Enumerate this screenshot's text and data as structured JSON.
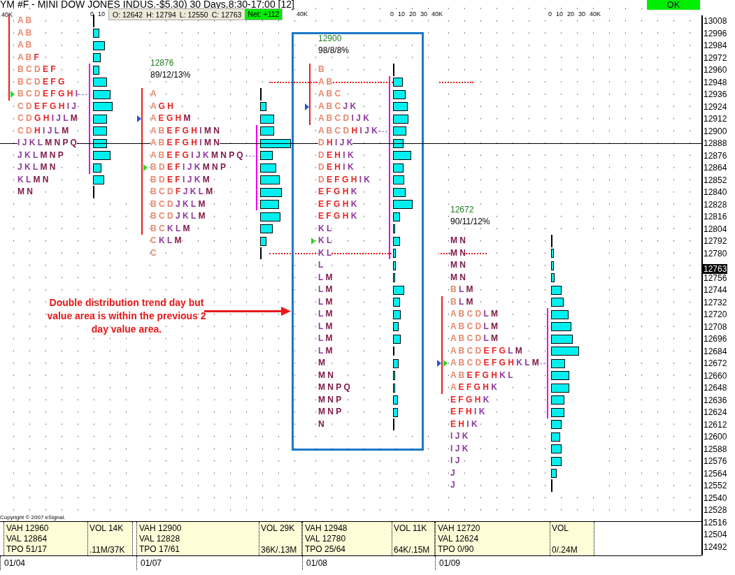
{
  "title": "YM #F - MINI DOW JONES INDUS.-$5.30) 30 Days,8:30-17:00 [12]",
  "ok_button": "OK",
  "ohlc": {
    "items": [
      {
        "label": "O:",
        "value": "12642"
      },
      {
        "label": "H:",
        "value": "12794"
      },
      {
        "label": "L:",
        "value": "12550"
      },
      {
        "label": "C:",
        "value": "12763"
      }
    ],
    "net": {
      "label": "Net:",
      "value": "+112"
    }
  },
  "corner_scale_label": "40K",
  "price_axis": {
    "labels": [
      "13008",
      "12996",
      "12984",
      "12972",
      "12960",
      "12948",
      "12936",
      "12924",
      "12912",
      "12900",
      "12888",
      "12876",
      "12864",
      "12852",
      "12840",
      "12828",
      "12816",
      "12804",
      "12792",
      "12780",
      "12756",
      "12744",
      "12732",
      "12720",
      "12708",
      "12696",
      "12684",
      "12672",
      "12660",
      "12648",
      "12636",
      "12624",
      "12612",
      "12600",
      "12588",
      "12576",
      "12564",
      "12552",
      "12540",
      "12528",
      "12516",
      "12504",
      "12492"
    ],
    "last_price": "12763"
  },
  "annotation": {
    "text": "Double distribution trend day but value area is within the previous 2 day value area."
  },
  "copyright": "Copyright © 2007 eSignal.",
  "days": [
    {
      "date": "01/04",
      "scale": {
        "kind": "head",
        "labels": [
          "0",
          "10"
        ]
      },
      "highlighted": false,
      "extended_value_area": false,
      "rows": [
        {
          "groups": [
            {
              "text": "A B",
              "color": "#e8886c"
            }
          ],
          "level": 0,
          "poc": false,
          "in_range": true,
          "value_area": false
        },
        {
          "groups": [
            {
              "text": "A B",
              "color": "#e8886c"
            }
          ],
          "level": 0.14,
          "poc": false,
          "in_range": true,
          "value_area": false
        },
        {
          "groups": [
            {
              "text": "A B",
              "color": "#e8886c"
            }
          ],
          "level": 0.26,
          "poc": false,
          "in_range": true,
          "value_area": false
        },
        {
          "groups": [
            {
              "text": "A B",
              "color": "#e8886c"
            },
            {
              "text": "F",
              "color": "#ee2020"
            }
          ],
          "level": 0.17,
          "poc": false,
          "in_range": true,
          "value_area": false
        },
        {
          "groups": [
            {
              "text": "B C D",
              "color": "#e8886c"
            },
            {
              "text": "E F",
              "color": "#ee2020"
            }
          ],
          "level": 0.14,
          "poc": false,
          "in_range": true,
          "value_area": true
        },
        {
          "groups": [
            {
              "text": "B C D",
              "color": "#e8886c"
            },
            {
              "text": "E F G",
              "color": "#ee2020"
            }
          ],
          "level": 0.31,
          "poc": false,
          "in_range": true,
          "value_area": true
        },
        {
          "groups": [
            {
              "text": "B C D",
              "color": "#e8886c"
            },
            {
              "text": "E F G H",
              "color": "#ee2020"
            },
            {
              "text": "I",
              "color": "#8e3a9e"
            }
          ],
          "level": 0.38,
          "poc": true,
          "in_range": true,
          "value_area": true,
          "markers": [
            {
              "kind": "inner",
              "color": "#22dd22"
            }
          ]
        },
        {
          "groups": [
            {
              "text": "C D",
              "color": "#e8886c"
            },
            {
              "text": "E F G H",
              "color": "#ee2020"
            },
            {
              "text": "I J",
              "color": "#8e3a9e"
            }
          ],
          "level": 0.43,
          "poc": false,
          "in_range": false,
          "value_area": true
        },
        {
          "groups": [
            {
              "text": "C D",
              "color": "#e8886c"
            },
            {
              "text": "G H",
              "color": "#ee2020"
            },
            {
              "text": "I J L",
              "color": "#8e3a9e"
            },
            {
              "text": "M",
              "color": "#801848"
            }
          ],
          "level": 0.31,
          "poc": false,
          "in_range": false,
          "value_area": true
        },
        {
          "groups": [
            {
              "text": "C D",
              "color": "#e8886c"
            },
            {
              "text": "H",
              "color": "#ee2020"
            },
            {
              "text": "I J L",
              "color": "#8e3a9e"
            },
            {
              "text": "M",
              "color": "#801848"
            }
          ],
          "level": 0.31,
          "poc": false,
          "in_range": false,
          "value_area": true
        },
        {
          "groups": [
            {
              "text": "I J K L",
              "color": "#8e3a9e"
            },
            {
              "text": "M N P Q",
              "color": "#801848"
            }
          ],
          "level": 0.31,
          "poc": false,
          "in_range": false,
          "value_area": true
        },
        {
          "groups": [
            {
              "text": "J K L",
              "color": "#8e3a9e"
            },
            {
              "text": "M N P",
              "color": "#801848"
            }
          ],
          "level": 0.38,
          "poc": false,
          "in_range": false,
          "value_area": true
        },
        {
          "groups": [
            {
              "text": "J K L",
              "color": "#8e3a9e"
            },
            {
              "text": "M N",
              "color": "#801848"
            }
          ],
          "level": 0.18,
          "poc": false,
          "in_range": false,
          "value_area": true
        },
        {
          "groups": [
            {
              "text": "K L",
              "color": "#8e3a9e"
            },
            {
              "text": "M N",
              "color": "#801848"
            }
          ],
          "level": 0.25,
          "poc": false,
          "in_range": false,
          "value_area": false
        },
        {
          "groups": [
            {
              "text": "M N",
              "color": "#801848"
            }
          ],
          "level": 0,
          "poc": false,
          "in_range": false,
          "value_area": false
        }
      ],
      "footer": {
        "stats": [
          {
            "label": "VAH",
            "value": "12960"
          },
          {
            "label": "VAL",
            "value": "12864"
          },
          {
            "label": "TPO",
            "value": "51/17"
          }
        ],
        "vol": {
          "label": "VOL",
          "value": "14K",
          "ratio": ".11M/37K"
        }
      }
    },
    {
      "date": "01/07",
      "poc_label": "12876",
      "stats_label": "89/12/13%",
      "scale": {
        "kind": "tail",
        "labels": [
          "40K"
        ]
      },
      "highlighted": false,
      "extended_value_area": false,
      "rows": [
        {
          "groups": [
            {
              "text": "A",
              "color": "#e8886c"
            }
          ],
          "level": 0,
          "poc": false,
          "in_range": true,
          "value_area": false
        },
        {
          "groups": [
            {
              "text": "A",
              "color": "#e8886c"
            },
            {
              "text": "G H",
              "color": "#ee2020"
            }
          ],
          "level": 0.14,
          "poc": false,
          "in_range": true,
          "value_area": false
        },
        {
          "groups": [
            {
              "text": "A",
              "color": "#e8886c"
            },
            {
              "text": "E G H",
              "color": "#ee2020"
            },
            {
              "text": "M",
              "color": "#801848"
            }
          ],
          "level": 0.31,
          "poc": false,
          "in_range": true,
          "value_area": false,
          "markers": [
            {
              "kind": "outer",
              "color": "#2255dd"
            }
          ]
        },
        {
          "groups": [
            {
              "text": "A B",
              "color": "#e8886c"
            },
            {
              "text": "E F G H",
              "color": "#ee2020"
            },
            {
              "text": "I",
              "color": "#8e3a9e"
            },
            {
              "text": "M N",
              "color": "#801848"
            }
          ],
          "level": 0.31,
          "poc": false,
          "in_range": true,
          "value_area": true
        },
        {
          "groups": [
            {
              "text": "A B",
              "color": "#e8886c"
            },
            {
              "text": "E F G H",
              "color": "#ee2020"
            },
            {
              "text": "I",
              "color": "#8e3a9e"
            },
            {
              "text": "M N",
              "color": "#801848"
            }
          ],
          "level": 0.68,
          "poc": false,
          "in_range": true,
          "value_area": true
        },
        {
          "groups": [
            {
              "text": "A B",
              "color": "#e8886c"
            },
            {
              "text": "E F G",
              "color": "#ee2020"
            },
            {
              "text": "I J K",
              "color": "#8e3a9e"
            },
            {
              "text": "M N P Q",
              "color": "#801848"
            }
          ],
          "level": 0.28,
          "poc": true,
          "in_range": true,
          "value_area": true
        },
        {
          "groups": [
            {
              "text": "B D",
              "color": "#e8886c"
            },
            {
              "text": "E F",
              "color": "#ee2020"
            },
            {
              "text": "I J K",
              "color": "#8e3a9e"
            },
            {
              "text": "M N P",
              "color": "#801848"
            }
          ],
          "level": 0.35,
          "poc": false,
          "in_range": true,
          "value_area": true,
          "markers": [
            {
              "kind": "inner",
              "color": "#22dd22"
            }
          ]
        },
        {
          "groups": [
            {
              "text": "B D",
              "color": "#e8886c"
            },
            {
              "text": "E F",
              "color": "#ee2020"
            },
            {
              "text": "I J K",
              "color": "#8e3a9e"
            },
            {
              "text": "M",
              "color": "#801848"
            }
          ],
          "level": 0.43,
          "poc": false,
          "in_range": true,
          "value_area": true
        },
        {
          "groups": [
            {
              "text": "B C D",
              "color": "#e8886c"
            },
            {
              "text": "F",
              "color": "#ee2020"
            },
            {
              "text": "J K L",
              "color": "#8e3a9e"
            },
            {
              "text": "M",
              "color": "#801848"
            }
          ],
          "level": 0.48,
          "poc": false,
          "in_range": true,
          "value_area": true
        },
        {
          "groups": [
            {
              "text": "B C D",
              "color": "#e8886c"
            },
            {
              "text": "J K L",
              "color": "#8e3a9e"
            },
            {
              "text": "M",
              "color": "#801848"
            }
          ],
          "level": 0.42,
          "poc": false,
          "in_range": true,
          "value_area": true
        },
        {
          "groups": [
            {
              "text": "B C D",
              "color": "#e8886c"
            },
            {
              "text": "J K L",
              "color": "#8e3a9e"
            },
            {
              "text": "M",
              "color": "#801848"
            }
          ],
          "level": 0.45,
          "poc": false,
          "in_range": true,
          "value_area": false
        },
        {
          "groups": [
            {
              "text": "B C",
              "color": "#e8886c"
            },
            {
              "text": "K L",
              "color": "#8e3a9e"
            },
            {
              "text": "M",
              "color": "#801848"
            }
          ],
          "level": 0.28,
          "poc": false,
          "in_range": true,
          "value_area": false
        },
        {
          "groups": [
            {
              "text": "C",
              "color": "#e8886c"
            },
            {
              "text": "K L",
              "color": "#8e3a9e"
            },
            {
              "text": "M",
              "color": "#801848"
            }
          ],
          "level": 0.14,
          "poc": false,
          "in_range": false,
          "value_area": false
        },
        {
          "groups": [
            {
              "text": "C",
              "color": "#e8886c"
            }
          ],
          "level": 0,
          "poc": false,
          "in_range": false,
          "value_area": false
        }
      ],
      "footer": {
        "stats": [
          {
            "label": "VAH",
            "value": "12900"
          },
          {
            "label": "VAL",
            "value": "12828"
          },
          {
            "label": "TPO",
            "value": "17/61"
          }
        ],
        "vol": {
          "label": "VOL",
          "value": "29K",
          "ratio": "36K/.13M"
        }
      }
    },
    {
      "date": "01/08",
      "poc_label": "12900",
      "stats_label": "98/8/8%",
      "scale": {
        "kind": "full",
        "labels": [
          "0",
          "10",
          "20",
          "30",
          "40K"
        ]
      },
      "highlighted": true,
      "extended_value_area": true,
      "rows": [
        {
          "groups": [
            {
              "text": "B",
              "color": "#e8886c"
            }
          ],
          "level": 0,
          "poc": false,
          "in_range": true,
          "value_area": false
        },
        {
          "groups": [
            {
              "text": "A B",
              "color": "#e8886c"
            }
          ],
          "level": 0.22,
          "poc": false,
          "in_range": true,
          "value_area": true
        },
        {
          "groups": [
            {
              "text": "A B C",
              "color": "#e8886c"
            }
          ],
          "level": 0.28,
          "poc": false,
          "in_range": true,
          "value_area": true
        },
        {
          "groups": [
            {
              "text": "A B C",
              "color": "#e8886c"
            },
            {
              "text": "J K",
              "color": "#8e3a9e"
            }
          ],
          "level": 0.32,
          "poc": false,
          "in_range": true,
          "value_area": true,
          "markers": [
            {
              "kind": "outer",
              "color": "#2255dd"
            }
          ]
        },
        {
          "groups": [
            {
              "text": "A B C D",
              "color": "#e8886c"
            },
            {
              "text": "I J K",
              "color": "#8e3a9e"
            }
          ],
          "level": 0.34,
          "poc": false,
          "in_range": true,
          "value_area": true
        },
        {
          "groups": [
            {
              "text": "A B C D",
              "color": "#e8886c"
            },
            {
              "text": "H",
              "color": "#ee2020"
            },
            {
              "text": "I J K",
              "color": "#8e3a9e"
            }
          ],
          "level": 0.29,
          "poc": true,
          "in_range": false,
          "value_area": true
        },
        {
          "groups": [
            {
              "text": "D",
              "color": "#e8886c"
            },
            {
              "text": "H",
              "color": "#ee2020"
            },
            {
              "text": "I J K",
              "color": "#8e3a9e"
            }
          ],
          "level": 0.23,
          "poc": false,
          "in_range": false,
          "value_area": true
        },
        {
          "groups": [
            {
              "text": "D",
              "color": "#e8886c"
            },
            {
              "text": "E H",
              "color": "#ee2020"
            },
            {
              "text": "I K",
              "color": "#8e3a9e"
            }
          ],
          "level": 0.4,
          "poc": false,
          "in_range": false,
          "value_area": true
        },
        {
          "groups": [
            {
              "text": "D",
              "color": "#e8886c"
            },
            {
              "text": "E H",
              "color": "#ee2020"
            },
            {
              "text": "I K",
              "color": "#8e3a9e"
            }
          ],
          "level": 0.23,
          "poc": false,
          "in_range": false,
          "value_area": true
        },
        {
          "groups": [
            {
              "text": "D",
              "color": "#e8886c"
            },
            {
              "text": "E F G H",
              "color": "#ee2020"
            },
            {
              "text": "I K",
              "color": "#8e3a9e"
            }
          ],
          "level": 0.25,
          "poc": false,
          "in_range": false,
          "value_area": true
        },
        {
          "groups": [
            {
              "text": "E F G H",
              "color": "#ee2020"
            },
            {
              "text": "K",
              "color": "#8e3a9e"
            }
          ],
          "level": 0.28,
          "poc": false,
          "in_range": false,
          "value_area": true
        },
        {
          "groups": [
            {
              "text": "E F G H",
              "color": "#ee2020"
            },
            {
              "text": "K",
              "color": "#8e3a9e"
            }
          ],
          "level": 0.43,
          "poc": false,
          "in_range": false,
          "value_area": true
        },
        {
          "groups": [
            {
              "text": "E F G H",
              "color": "#ee2020"
            },
            {
              "text": "K",
              "color": "#8e3a9e"
            }
          ],
          "level": 0.15,
          "poc": false,
          "in_range": false,
          "value_area": true
        },
        {
          "groups": [
            {
              "text": "K L",
              "color": "#8e3a9e"
            }
          ],
          "level": 0.05,
          "poc": false,
          "in_range": false,
          "value_area": true
        },
        {
          "groups": [
            {
              "text": "K L",
              "color": "#8e3a9e"
            }
          ],
          "level": 0.15,
          "poc": false,
          "in_range": false,
          "value_area": true,
          "markers": [
            {
              "kind": "inner",
              "color": "#22dd22"
            }
          ]
        },
        {
          "groups": [
            {
              "text": "K L",
              "color": "#8e3a9e"
            }
          ],
          "level": 0.06,
          "poc": false,
          "in_range": false,
          "value_area": true
        },
        {
          "groups": [
            {
              "text": "L",
              "color": "#8e3a9e"
            }
          ],
          "level": 0.06,
          "poc": false,
          "in_range": false,
          "value_area": false
        },
        {
          "groups": [
            {
              "text": "L",
              "color": "#8e3a9e"
            },
            {
              "text": "M",
              "color": "#801848"
            }
          ],
          "level": 0.05,
          "poc": false,
          "in_range": false,
          "value_area": false
        },
        {
          "groups": [
            {
              "text": "L",
              "color": "#8e3a9e"
            },
            {
              "text": "M",
              "color": "#801848"
            }
          ],
          "level": 0.25,
          "poc": false,
          "in_range": false,
          "value_area": false
        },
        {
          "groups": [
            {
              "text": "L",
              "color": "#8e3a9e"
            },
            {
              "text": "M",
              "color": "#801848"
            }
          ],
          "level": 0.15,
          "poc": false,
          "in_range": false,
          "value_area": false
        },
        {
          "groups": [
            {
              "text": "L",
              "color": "#8e3a9e"
            },
            {
              "text": "M",
              "color": "#801848"
            }
          ],
          "level": 0.17,
          "poc": false,
          "in_range": false,
          "value_area": false
        },
        {
          "groups": [
            {
              "text": "L",
              "color": "#8e3a9e"
            },
            {
              "text": "M",
              "color": "#801848"
            }
          ],
          "level": 0.12,
          "poc": false,
          "in_range": false,
          "value_area": false
        },
        {
          "groups": [
            {
              "text": "L",
              "color": "#8e3a9e"
            },
            {
              "text": "M",
              "color": "#801848"
            }
          ],
          "level": 0.17,
          "poc": false,
          "in_range": false,
          "value_area": false
        },
        {
          "groups": [
            {
              "text": "L",
              "color": "#8e3a9e"
            },
            {
              "text": "M",
              "color": "#801848"
            }
          ],
          "level": 0.03,
          "poc": false,
          "in_range": false,
          "value_area": false
        },
        {
          "groups": [
            {
              "text": "M",
              "color": "#801848"
            }
          ],
          "level": 0.12,
          "poc": false,
          "in_range": false,
          "value_area": false
        },
        {
          "groups": [
            {
              "text": "M N",
              "color": "#801848"
            }
          ],
          "level": 0.05,
          "poc": false,
          "in_range": false,
          "value_area": false
        },
        {
          "groups": [
            {
              "text": "M N P Q",
              "color": "#801848"
            }
          ],
          "level": 0.05,
          "poc": false,
          "in_range": false,
          "value_area": false
        },
        {
          "groups": [
            {
              "text": "M N P",
              "color": "#801848"
            }
          ],
          "level": 0.11,
          "poc": false,
          "in_range": false,
          "value_area": false
        },
        {
          "groups": [
            {
              "text": "M N P",
              "color": "#801848"
            }
          ],
          "level": 0.11,
          "poc": false,
          "in_range": false,
          "value_area": false
        },
        {
          "groups": [
            {
              "text": "N",
              "color": "#801848"
            }
          ],
          "level": 0,
          "poc": false,
          "in_range": false,
          "value_area": false
        }
      ],
      "footer": {
        "stats": [
          {
            "label": "VAH",
            "value": "12948"
          },
          {
            "label": "VAL",
            "value": "12780"
          },
          {
            "label": "TPO",
            "value": "25/64"
          }
        ],
        "vol": {
          "label": "VOL",
          "value": "11K",
          "ratio": "64K/.15M"
        }
      }
    },
    {
      "date": "01/09",
      "poc_label": "12672",
      "stats_label": "90/11/12%",
      "scale": {
        "kind": "full",
        "labels": [
          "0",
          "10",
          "20",
          "30",
          "40K"
        ]
      },
      "highlighted": false,
      "extended_value_area": false,
      "rows": [
        {
          "groups": [
            {
              "text": "M N",
              "color": "#801848"
            }
          ],
          "level": 0,
          "poc": false,
          "in_range": false,
          "value_area": false
        },
        {
          "groups": [
            {
              "text": "M N",
              "color": "#801848"
            }
          ],
          "level": 0.06,
          "poc": false,
          "in_range": false,
          "value_area": false
        },
        {
          "groups": [
            {
              "text": "M N",
              "color": "#801848"
            }
          ],
          "level": 0.06,
          "poc": false,
          "in_range": false,
          "value_area": false
        },
        {
          "groups": [
            {
              "text": "M N",
              "color": "#801848"
            }
          ],
          "level": 0.08,
          "poc": false,
          "in_range": false,
          "value_area": false
        },
        {
          "groups": [
            {
              "text": "B",
              "color": "#e8886c"
            },
            {
              "text": "L",
              "color": "#8e3a9e"
            },
            {
              "text": "M",
              "color": "#801848"
            }
          ],
          "level": 0.23,
          "poc": false,
          "in_range": false,
          "value_area": false
        },
        {
          "groups": [
            {
              "text": "B",
              "color": "#e8886c"
            },
            {
              "text": "L",
              "color": "#8e3a9e"
            },
            {
              "text": "M",
              "color": "#801848"
            }
          ],
          "level": 0.28,
          "poc": false,
          "in_range": true,
          "value_area": false
        },
        {
          "groups": [
            {
              "text": "A B C D",
              "color": "#e8886c"
            },
            {
              "text": "L",
              "color": "#8e3a9e"
            },
            {
              "text": "M",
              "color": "#801848"
            }
          ],
          "level": 0.38,
          "poc": false,
          "in_range": true,
          "value_area": true
        },
        {
          "groups": [
            {
              "text": "A B C D",
              "color": "#e8886c"
            },
            {
              "text": "L",
              "color": "#8e3a9e"
            },
            {
              "text": "M",
              "color": "#801848"
            }
          ],
          "level": 0.45,
          "poc": false,
          "in_range": true,
          "value_area": true
        },
        {
          "groups": [
            {
              "text": "A B C D",
              "color": "#e8886c"
            },
            {
              "text": "L",
              "color": "#8e3a9e"
            },
            {
              "text": "M",
              "color": "#801848"
            }
          ],
          "level": 0.48,
          "poc": false,
          "in_range": true,
          "value_area": true
        },
        {
          "groups": [
            {
              "text": "A B C D",
              "color": "#e8886c"
            },
            {
              "text": "E F G",
              "color": "#ee2020"
            },
            {
              "text": "L",
              "color": "#8e3a9e"
            },
            {
              "text": "M",
              "color": "#801848"
            }
          ],
          "level": 0.62,
          "poc": false,
          "in_range": true,
          "value_area": true
        },
        {
          "groups": [
            {
              "text": "A B C D",
              "color": "#e8886c"
            },
            {
              "text": "E F G H",
              "color": "#ee2020"
            },
            {
              "text": "K L",
              "color": "#8e3a9e"
            },
            {
              "text": "M",
              "color": "#801848"
            }
          ],
          "level": 0.31,
          "poc": true,
          "in_range": true,
          "value_area": true,
          "markers": [
            {
              "kind": "outer",
              "color": "#2255dd"
            },
            {
              "kind": "inner",
              "color": "#22dd22"
            }
          ]
        },
        {
          "groups": [
            {
              "text": "A B",
              "color": "#e8886c"
            },
            {
              "text": "E F G H",
              "color": "#ee2020"
            },
            {
              "text": "K L",
              "color": "#8e3a9e"
            }
          ],
          "level": 0.4,
          "poc": false,
          "in_range": true,
          "value_area": true
        },
        {
          "groups": [
            {
              "text": "A",
              "color": "#e8886c"
            },
            {
              "text": "E F G H",
              "color": "#ee2020"
            },
            {
              "text": "K",
              "color": "#8e3a9e"
            }
          ],
          "level": 0.4,
          "poc": false,
          "in_range": true,
          "value_area": true
        },
        {
          "groups": [
            {
              "text": "E F G H",
              "color": "#ee2020"
            },
            {
              "text": "K",
              "color": "#8e3a9e"
            }
          ],
          "level": 0.29,
          "poc": false,
          "in_range": false,
          "value_area": true
        },
        {
          "groups": [
            {
              "text": "E F H",
              "color": "#ee2020"
            },
            {
              "text": "I K",
              "color": "#8e3a9e"
            }
          ],
          "level": 0.29,
          "poc": false,
          "in_range": false,
          "value_area": true
        },
        {
          "groups": [
            {
              "text": "E H",
              "color": "#ee2020"
            },
            {
              "text": "I K",
              "color": "#8e3a9e"
            }
          ],
          "level": 0.23,
          "poc": false,
          "in_range": false,
          "value_area": false
        },
        {
          "groups": [
            {
              "text": "I J K",
              "color": "#8e3a9e"
            }
          ],
          "level": 0.2,
          "poc": false,
          "in_range": false,
          "value_area": false
        },
        {
          "groups": [
            {
              "text": "I J K",
              "color": "#8e3a9e"
            }
          ],
          "level": 0.23,
          "poc": false,
          "in_range": false,
          "value_area": false
        },
        {
          "groups": [
            {
              "text": "I J",
              "color": "#8e3a9e"
            }
          ],
          "level": 0.23,
          "poc": false,
          "in_range": false,
          "value_area": false
        },
        {
          "groups": [
            {
              "text": "J",
              "color": "#8e3a9e"
            }
          ],
          "level": 0.12,
          "poc": false,
          "in_range": false,
          "value_area": false
        },
        {
          "groups": [
            {
              "text": "J",
              "color": "#8e3a9e"
            }
          ],
          "level": 0,
          "poc": false,
          "in_range": false,
          "value_area": false
        }
      ],
      "footer": {
        "stats": [
          {
            "label": "VAH",
            "value": "12720"
          },
          {
            "label": "VAL",
            "value": "12624"
          },
          {
            "label": "TPO",
            "value": "0/90"
          }
        ],
        "vol": {
          "label": "VOL",
          "ratio": "0/.24M"
        }
      }
    }
  ]
}
